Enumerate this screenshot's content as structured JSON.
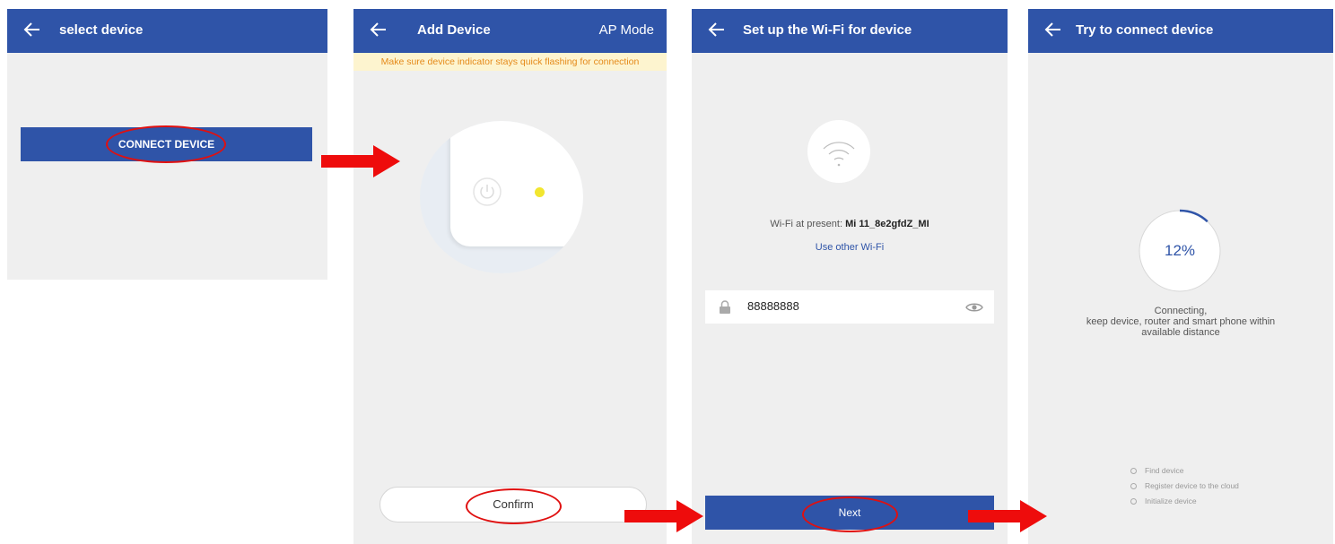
{
  "screens": [
    {
      "title": "select device",
      "button": "CONNECT DEVICE"
    },
    {
      "title": "Add Device",
      "mode": "AP Mode",
      "notice": "Make sure device indicator stays quick flashing for connection",
      "button": "Confirm"
    },
    {
      "title": "Set up the Wi-Fi for device",
      "wifi_label": "Wi-Fi at present:",
      "wifi_name": "Mi 11_8e2gfdZ_MI",
      "other_wifi": "Use other Wi-Fi",
      "password": "88888888",
      "button": "Next"
    },
    {
      "title": "Try to connect device",
      "progress": "12%",
      "progress_value": 0.12,
      "status": [
        "Connecting,",
        "keep device, router and smart phone within",
        "available distance"
      ],
      "steps": [
        "Find device",
        "Register device to the cloud",
        "Initialize device"
      ]
    }
  ],
  "colors": {
    "header": "#2f54a8",
    "annotation": "#e01010",
    "notice_bg": "#fdf4cf",
    "notice_text": "#e58a1a"
  },
  "icons": [
    "back-arrow-icon",
    "power-icon",
    "wifi-icon",
    "lock-icon",
    "eye-icon",
    "flow-arrow-icon"
  ]
}
